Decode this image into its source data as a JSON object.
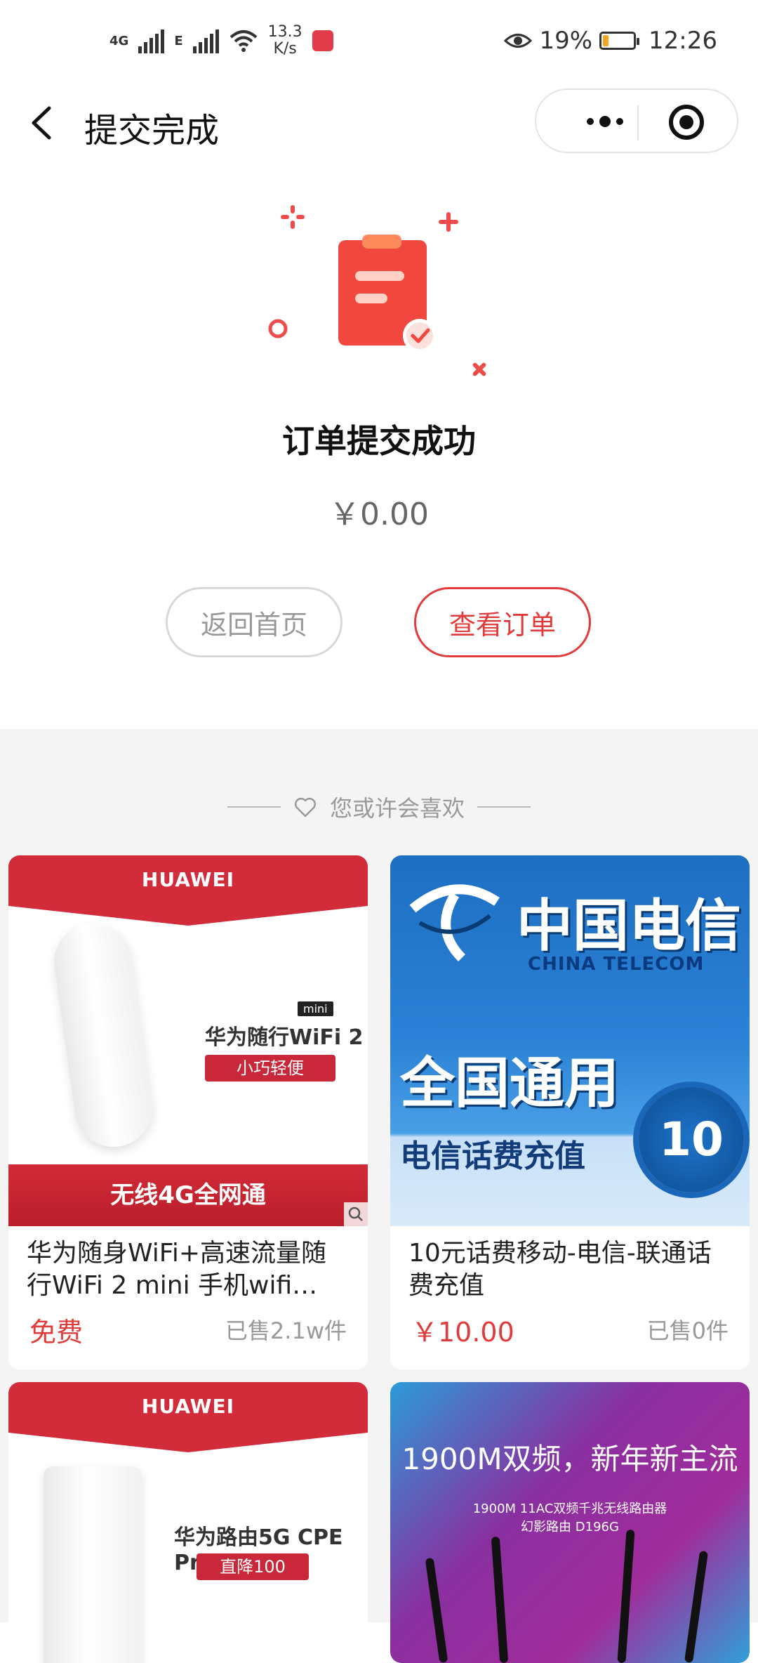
{
  "status_bar": {
    "net1": "4G",
    "net2": "E",
    "speed_value": "13.3",
    "speed_unit": "K/s",
    "battery_percent": "19%",
    "time": "12:26",
    "battery_level": 0.19
  },
  "nav": {
    "title": "提交完成"
  },
  "success": {
    "title": "订单提交成功",
    "amount": "￥0.00"
  },
  "buttons": {
    "home": "返回首页",
    "view_order": "查看订单"
  },
  "recommend": {
    "header": "您或许会喜欢"
  },
  "products": [
    {
      "image": {
        "brand": "HUAWEI",
        "model": "华为随行WiFi 2",
        "mini_tag": "mini",
        "feature_tag": "小巧轻便",
        "bottom_banner": "无线4G全网通"
      },
      "title": "华为随身WiFi+高速流量随行WiFi 2 mini 手机wifi…",
      "price": "免费",
      "sold": "已售2.1w件"
    },
    {
      "image": {
        "logo_cn": "中国电信",
        "logo_en": "CHINA TELECOM",
        "headline": "全国通用",
        "subline": "电信话费充值",
        "badge": "10"
      },
      "title": "10元话费移动-电信-联通话费充值",
      "price": "￥10.00",
      "sold": "已售0件"
    },
    {
      "image": {
        "brand": "HUAWEI",
        "model": "华为路由5G CPE Pro",
        "feature_tag": "直降100"
      }
    },
    {
      "image": {
        "headline": "1900M双频，新年新主流",
        "sub1": "1900M 11AC双频千兆无线路由器",
        "sub2": "幻影路由 D196G"
      }
    }
  ],
  "colors": {
    "accent_red": "#e23b3b",
    "huawei_red": "#d22c3b",
    "section_bg": "#f4f4f4",
    "muted_text": "#999999"
  }
}
